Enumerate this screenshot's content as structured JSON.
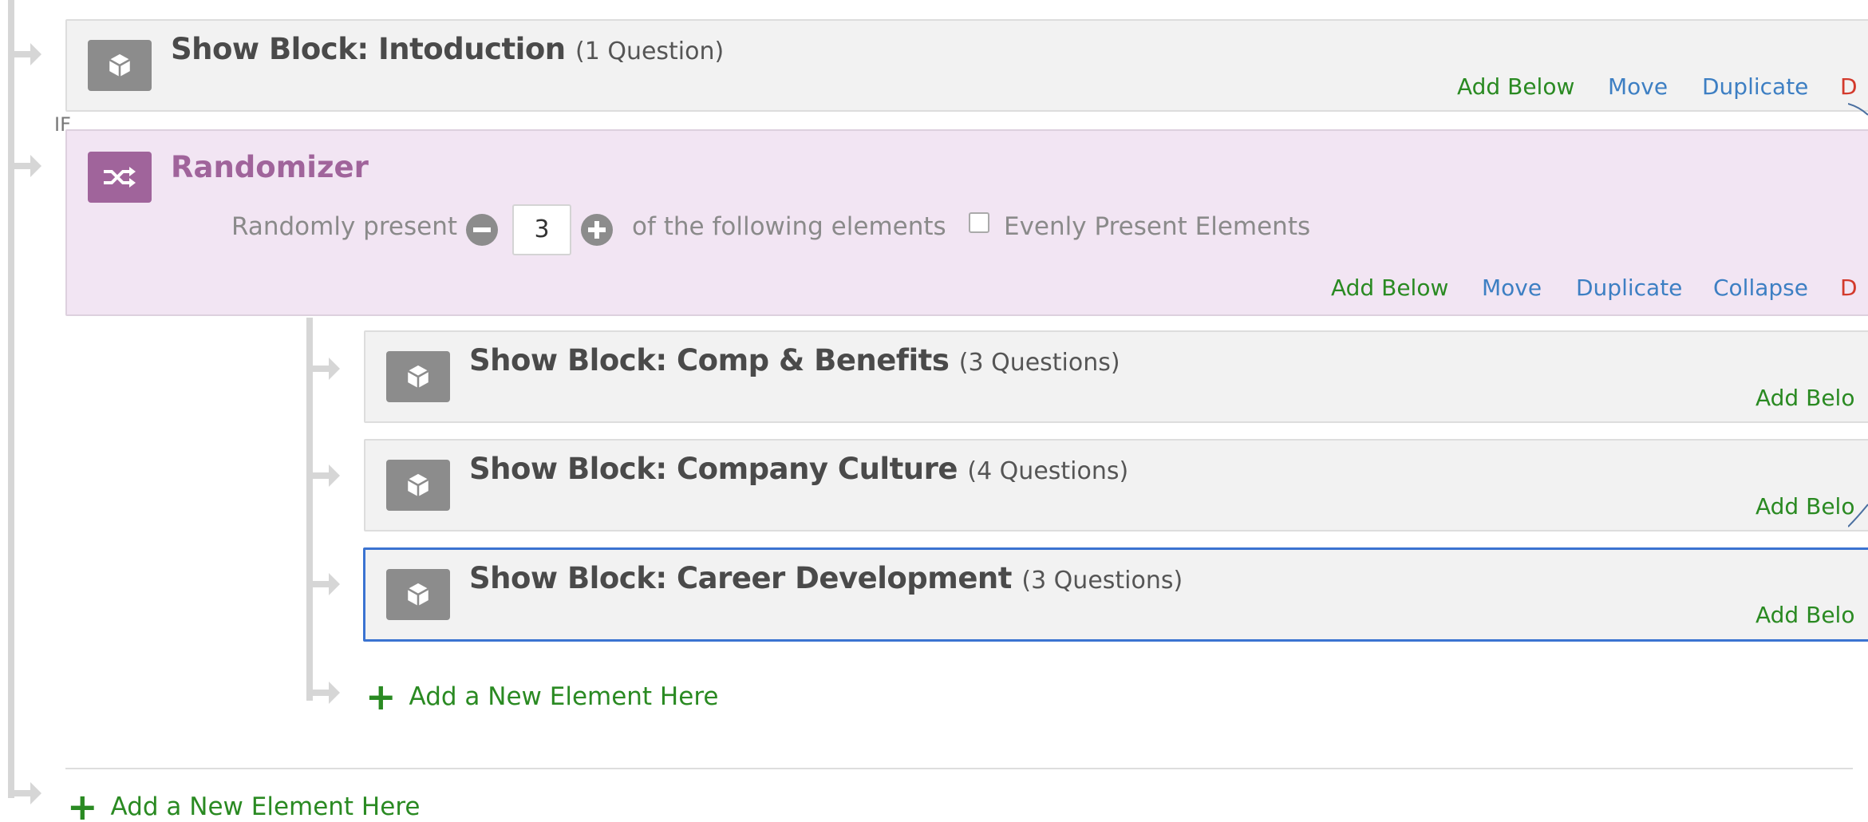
{
  "intro_block": {
    "title": "Show Block: Intoduction",
    "count": "(1 Question)",
    "actions": [
      "Add Below",
      "Move",
      "Duplicate",
      "D"
    ]
  },
  "if_label": "IF",
  "randomizer": {
    "title": "Randomizer",
    "present_label": "Randomly present",
    "count_value": "3",
    "following_label": "of the following elements",
    "evenly_label": "Evenly Present Elements",
    "evenly_checked": false,
    "actions": [
      "Add Below",
      "Move",
      "Duplicate",
      "Collapse",
      "D"
    ]
  },
  "child_blocks": [
    {
      "title": "Show Block: Comp & Benefits",
      "count": "(3 Questions)",
      "action": "Add Belo"
    },
    {
      "title": "Show Block: Company Culture",
      "count": "(4 Questions)",
      "action": "Add Belo"
    },
    {
      "title": "Show Block: Career Development",
      "count": "(3 Questions)",
      "action": "Add Belo"
    }
  ],
  "add_element_inner": "Add a New Element Here",
  "add_element_outer": "Add a New Element Here",
  "colors": {
    "green_action": "#2a8a22",
    "blue_action": "#3d7fc3",
    "red_action": "#d33a2c",
    "randomizer_accent": "#a0649b",
    "randomizer_bg": "#f2e5f3",
    "selected_border": "#3b73d1"
  },
  "icons": {
    "block": "cube-icon",
    "randomizer": "shuffle-icon",
    "minus": "minus-circle-icon",
    "plus": "plus-circle-icon",
    "add": "plus-icon",
    "connector": "connector-arrow-icon"
  }
}
